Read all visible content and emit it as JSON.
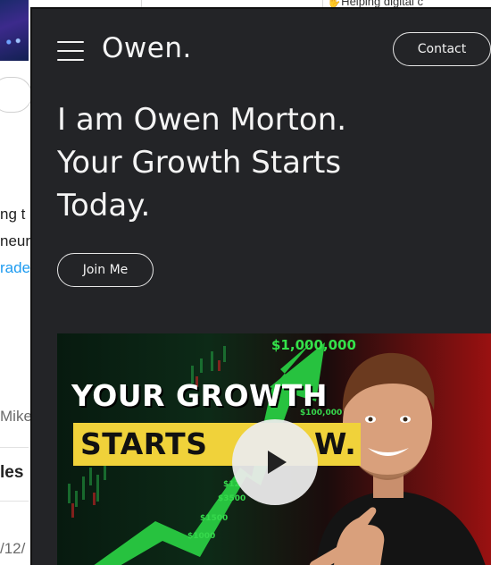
{
  "background": {
    "top_right_text": "✋Helping digital c",
    "lines": [
      "ng t",
      "neur",
      "rade"
    ],
    "mention": "Mike",
    "heading": "les",
    "date": "/12/"
  },
  "site": {
    "logo": "Owen.",
    "contact_label": "Contact",
    "headline": [
      "I am Owen Morton.",
      "Your Growth Starts",
      "Today."
    ],
    "join_label": "Join Me"
  },
  "video": {
    "money_top": "$1,000,000",
    "money_labels": [
      "$100,000",
      "$12",
      "$3500",
      "$1500",
      "$1000"
    ],
    "line1": "YOUR GROWTH",
    "line2": "STARTS",
    "line2_tail": "W."
  },
  "colors": {
    "site_bg": "#232427",
    "accent_green": "#34e24a",
    "band_yellow": "#f0d23a",
    "link_blue": "#1d9bf0"
  },
  "icons": {
    "menu": "hamburger-icon",
    "play": "play-icon"
  }
}
